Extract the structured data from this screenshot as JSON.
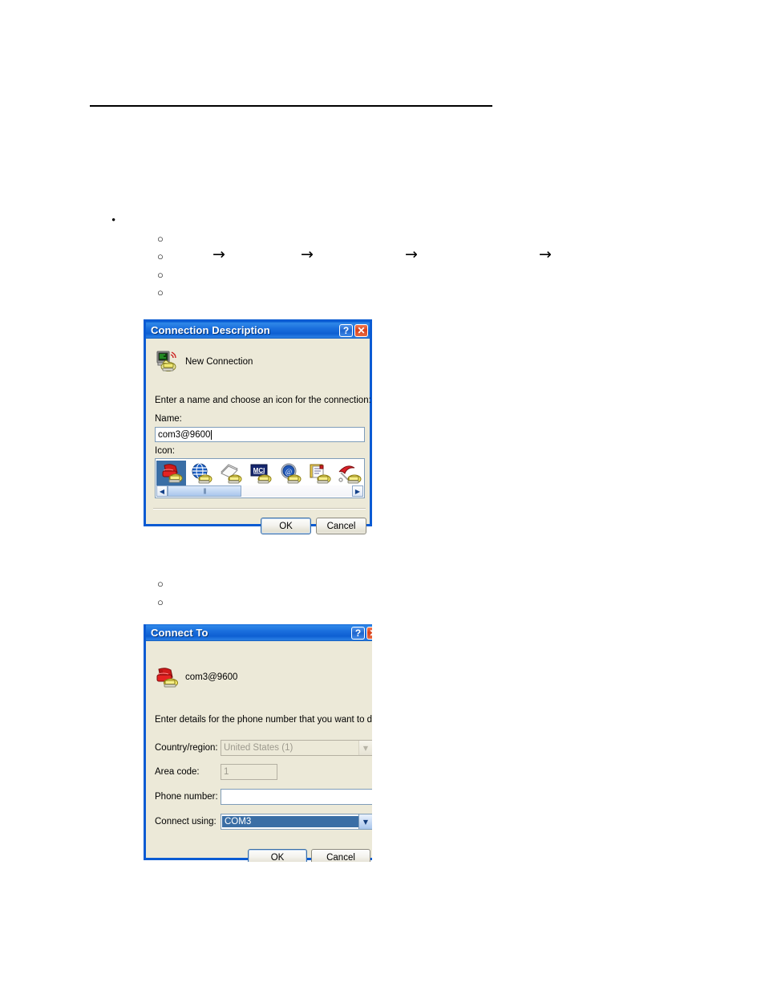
{
  "document": {
    "markers": {
      "bullet_disc": "•",
      "bullet_circle": "○",
      "arrow": "→"
    }
  },
  "dialog_connection_description": {
    "title": "Connection Description",
    "titlebar_buttons": {
      "help_label": "?",
      "close_label": "✕",
      "help_icon": "question-mark-icon",
      "close_icon": "close-x-icon"
    },
    "header_icon": "new-connection-computer-phone-icon",
    "header_label": "New Connection",
    "instruction": "Enter a name and choose an icon for the connection:",
    "name_label": "Name:",
    "name_value": "com3@9600",
    "icon_label": "Icon:",
    "icon_options": [
      {
        "name": "red-phone-icon",
        "selected": true
      },
      {
        "name": "blue-globe-icon",
        "selected": false
      },
      {
        "name": "paper-stack-icon",
        "selected": false
      },
      {
        "name": "mci-logo-icon",
        "selected": false
      },
      {
        "name": "at-globe-icon",
        "selected": false
      },
      {
        "name": "document-notepad-icon",
        "selected": false
      },
      {
        "name": "red-umbrella-icon",
        "selected": false
      }
    ],
    "scroll_left_label": "◀",
    "scroll_right_label": "▶",
    "ok_label": "OK",
    "cancel_label": "Cancel"
  },
  "dialog_connect_to": {
    "title": "Connect To",
    "titlebar_buttons": {
      "help_label": "?",
      "close_label": "✕",
      "help_icon": "question-mark-icon",
      "close_icon": "close-x-icon"
    },
    "header_icon": "red-phone-modem-icon",
    "header_label": "com3@9600",
    "instruction": "Enter details for the phone number that you want to dial:",
    "fields": [
      {
        "label": "Country/region:",
        "value": "United States (1)",
        "type": "combo",
        "disabled": true
      },
      {
        "label": "Area code:",
        "value": "1",
        "type": "text",
        "disabled": true
      },
      {
        "label": "Phone number:",
        "value": "",
        "type": "text",
        "disabled": false
      },
      {
        "label": "Connect using:",
        "value": "COM3",
        "type": "combo",
        "disabled": false
      }
    ],
    "dropdown_glyph": "▼",
    "ok_label": "OK",
    "cancel_label": "Cancel"
  },
  "colors": {
    "titlebar_blue": "#0a5bd3",
    "dialog_face": "#ece9d8",
    "selection_blue": "#3a6ea5",
    "field_border": "#7f9db9",
    "close_red": "#d9421c"
  }
}
